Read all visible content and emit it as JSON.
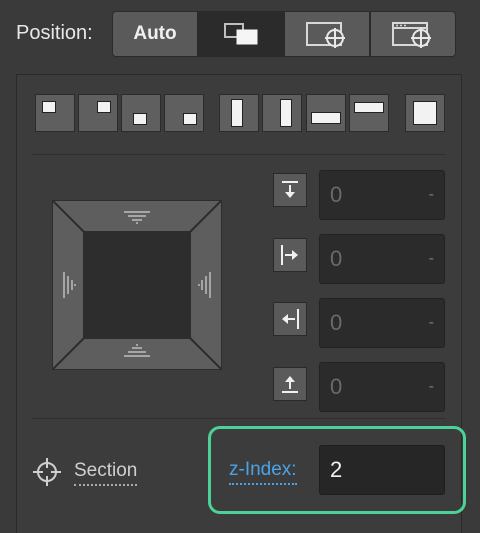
{
  "position": {
    "label": "Position:",
    "options": [
      {
        "label": "Auto",
        "icon": "auto"
      },
      {
        "label": "",
        "icon": "relative-layers-icon",
        "selected": true
      },
      {
        "label": "",
        "icon": "absolute-window-icon"
      },
      {
        "label": "",
        "icon": "fixed-window-icon"
      }
    ]
  },
  "presets": [
    {
      "icon": "top-left-preset-icon"
    },
    {
      "icon": "top-right-preset-icon"
    },
    {
      "icon": "bottom-left-preset-icon"
    },
    {
      "icon": "bottom-right-preset-icon"
    },
    {
      "icon": "left-full-preset-icon"
    },
    {
      "icon": "right-full-preset-icon"
    },
    {
      "icon": "bottom-full-preset-icon"
    },
    {
      "icon": "top-full-preset-icon"
    },
    {
      "icon": "full-preset-icon"
    }
  ],
  "offsets": {
    "top": {
      "value": "0",
      "unit": "-"
    },
    "left": {
      "value": "0",
      "unit": "-"
    },
    "right": {
      "value": "0",
      "unit": "-"
    },
    "bottom": {
      "value": "0",
      "unit": "-"
    }
  },
  "section": {
    "label": "Section"
  },
  "zindex": {
    "label": "z-Index:",
    "value": "2"
  },
  "colors": {
    "highlight": "#4cd196",
    "link": "#4aa3e8"
  }
}
